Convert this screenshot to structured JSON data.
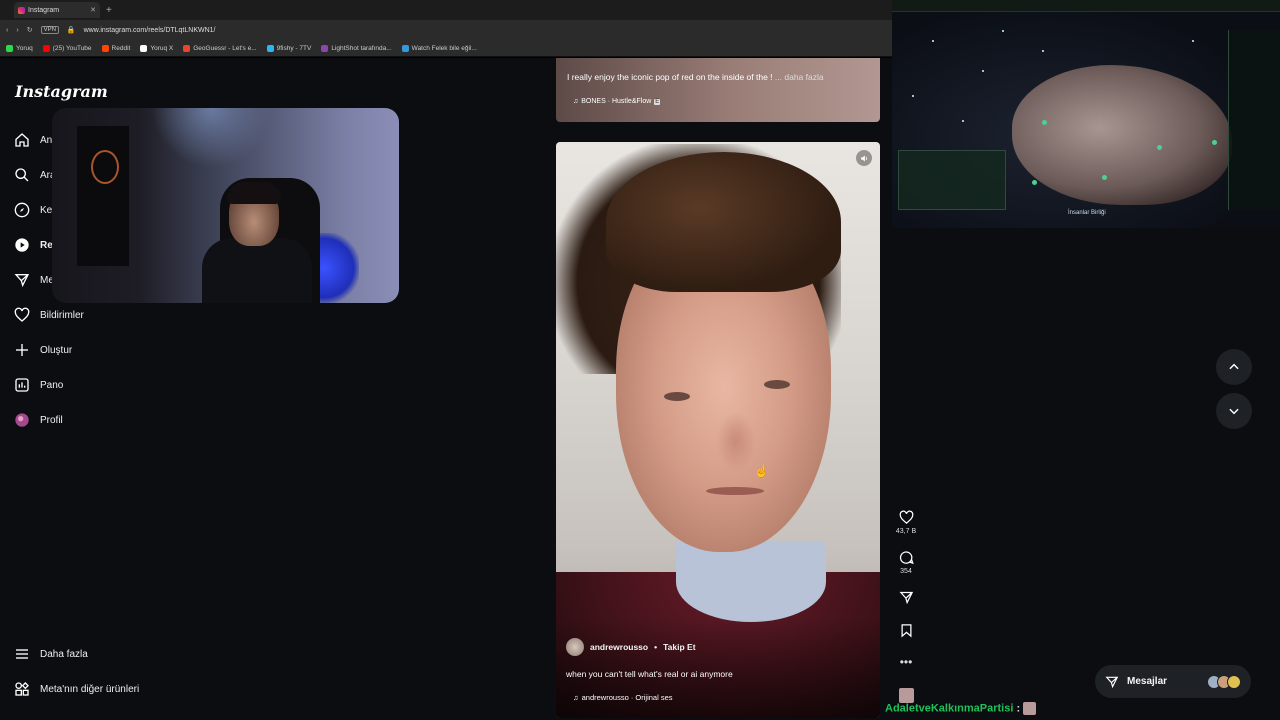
{
  "browser": {
    "tab_title": "Instagram",
    "url": "www.instagram.com/reels/DTLqtLNKWN1/",
    "vpn_label": "VPN",
    "bookmarks": [
      {
        "label": "Yoruq",
        "color": "#2bd94a"
      },
      {
        "label": "(25) YouTube",
        "color": "#ff0000"
      },
      {
        "label": "Reddit",
        "color": "#ff4500"
      },
      {
        "label": "Yoruq X",
        "color": "#ffffff"
      },
      {
        "label": "GeoGuessr - Let's e...",
        "color": "#e8452c"
      },
      {
        "label": "9fishy - 7TV",
        "color": "#29b6f6"
      },
      {
        "label": "LightShot tarafında...",
        "color": "#8e44ad"
      },
      {
        "label": "Watch Felek bile eğil...",
        "color": "#3498db"
      }
    ]
  },
  "instagram": {
    "logo": "Instagram",
    "nav": [
      {
        "label": "An",
        "icon": "home-icon"
      },
      {
        "label": "Ara",
        "icon": "search-icon"
      },
      {
        "label": "Ke",
        "icon": "explore-icon"
      },
      {
        "label": "Re",
        "icon": "reels-icon"
      },
      {
        "label": "Me",
        "icon": "messages-icon"
      },
      {
        "label": "Bildirimler",
        "icon": "heart-icon"
      },
      {
        "label": "Oluştur",
        "icon": "plus-icon"
      },
      {
        "label": "Pano",
        "icon": "dashboard-icon"
      },
      {
        "label": "Profil",
        "icon": "profile-icon"
      }
    ],
    "more_label": "Daha fazla",
    "meta_label": "Meta'nın diğer ürünleri"
  },
  "reel_previous": {
    "caption": "I really enjoy the iconic pop of red on the inside of the !",
    "more": "... daha fazla",
    "audio": "BONES · Hustle&Flow",
    "explicit_badge": "E"
  },
  "reel_current": {
    "username": "andrewrousso",
    "separator": "•",
    "follow_label": "Takip Et",
    "caption": "when you can't tell what's real or ai anymore",
    "audio": "andrewrousso · Orijinal ses",
    "likes": "43,7 B",
    "comments": "354"
  },
  "messages_bar": {
    "label": "Mesajlar"
  },
  "game_overlay": {
    "empire_label": "İnsanlar Birliği"
  },
  "chat": {
    "username": "AdaletveKalkınmaPartisi",
    "colon": ":"
  },
  "colors": {
    "chat_username": "#21c05a",
    "background": "#0b0d10"
  }
}
